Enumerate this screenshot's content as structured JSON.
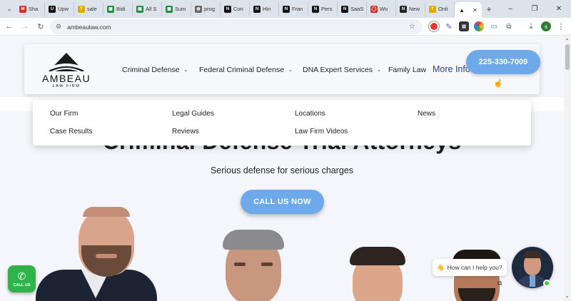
{
  "browser": {
    "tabs": [
      {
        "label": "Sha",
        "icon": "gmail-icon",
        "color": "#d93025",
        "glyph": "M"
      },
      {
        "label": "Upw",
        "icon": "upwork-icon",
        "color": "#111111",
        "glyph": "U"
      },
      {
        "label": "sale",
        "icon": "doc-icon",
        "color": "#e0a800",
        "glyph": "T"
      },
      {
        "label": "Bidi",
        "icon": "sheets-icon",
        "color": "#1e8e3e",
        "glyph": "▦"
      },
      {
        "label": "All S",
        "icon": "sheets-icon",
        "color": "#1e8e3e",
        "glyph": "▦"
      },
      {
        "label": "Sum",
        "icon": "sheets-icon",
        "color": "#1e8e3e",
        "glyph": "▦"
      },
      {
        "label": "prog",
        "icon": "globe-icon",
        "color": "#666666",
        "glyph": "◍"
      },
      {
        "label": "Con",
        "icon": "notion-icon",
        "color": "#111111",
        "glyph": "N"
      },
      {
        "label": "Hiri",
        "icon": "notion-icon",
        "color": "#111111",
        "glyph": "N"
      },
      {
        "label": "Fran",
        "icon": "notion-icon",
        "color": "#111111",
        "glyph": "N"
      },
      {
        "label": "Pers",
        "icon": "notion-icon",
        "color": "#111111",
        "glyph": "N"
      },
      {
        "label": "SaaS",
        "icon": "notion-icon",
        "color": "#111111",
        "glyph": "N"
      },
      {
        "label": "Wo",
        "icon": "circle-icon",
        "color": "#d93025",
        "glyph": "◯"
      },
      {
        "label": "New",
        "icon": "news-icon",
        "color": "#222222",
        "glyph": "N"
      },
      {
        "label": "Onli",
        "icon": "doc-icon",
        "color": "#e0a800",
        "glyph": "T"
      }
    ],
    "active_tab": {
      "label": "",
      "close": "✕"
    },
    "new_tab": "+",
    "window_controls": {
      "minimize": "–",
      "restore": "❐",
      "close": "✕"
    },
    "url": "ambeaulaw.com"
  },
  "site": {
    "logo": {
      "name": "AMBEAU",
      "tagline": "LAW FIRM"
    },
    "nav": [
      {
        "label": "Criminal Defense",
        "chevron": "⌄"
      },
      {
        "label": "Federal Criminal Defense",
        "chevron": "⌄"
      },
      {
        "label": "DNA Expert Services",
        "chevron": "⌄"
      },
      {
        "label": "Family Law",
        "chevron": ""
      }
    ],
    "more_info": {
      "label": "More Info",
      "chevron": "⌄"
    },
    "phone": "225-330-7009",
    "dropdown": {
      "col1": [
        "Our Firm",
        "Case Results"
      ],
      "col2": [
        "Legal Guides",
        "Reviews"
      ],
      "col3": [
        "Locations",
        "Law Firm Videos"
      ],
      "col4": [
        "News"
      ]
    },
    "hero": {
      "title": "Criminal Defense Trial Attorneys",
      "subtitle": "Serious defense for serious charges",
      "cta": "CALL US NOW"
    },
    "call_widget": {
      "label": "CALL US",
      "icon": "phone-icon"
    },
    "chat": {
      "emoji": "👋",
      "prompt": "How can I help you?"
    }
  }
}
